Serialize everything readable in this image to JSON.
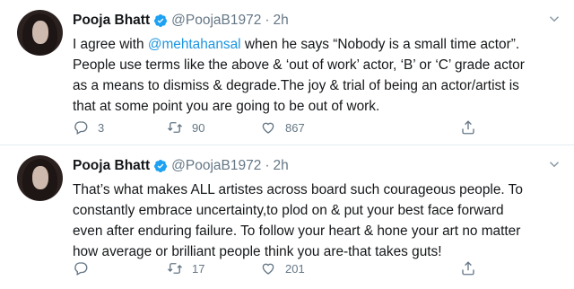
{
  "tweets": [
    {
      "name": "Pooja Bhatt",
      "handle": "@PoojaB1972",
      "dot": "·",
      "time": "2h",
      "lines": [
        {
          "pre": "I agree with ",
          "mention": "@mehtahansal",
          "post": " when he says “Nobody is a small time actor”."
        },
        {
          "text": "People use terms like the above & ‘out of work’ actor, ‘B’ or ‘C’ grade actor"
        },
        {
          "text": "as a means to dismiss & degrade.The joy & trial of being an actor/artist is"
        },
        {
          "text": "that at some point you are going to be out of work."
        }
      ],
      "replies": "3",
      "retweets": "90",
      "likes": "867"
    },
    {
      "name": "Pooja Bhatt",
      "handle": "@PoojaB1972",
      "dot": "·",
      "time": "2h",
      "lines": [
        {
          "text": "That’s what makes ALL artistes across board such courageous people. To"
        },
        {
          "text": "constantly embrace uncertainty,to plod on & put your best face forward"
        },
        {
          "text": "even after enduring failure. To follow your heart & hone your art no matter"
        },
        {
          "text": "how average or brilliant people think you are-that takes guts!"
        }
      ],
      "replies": "",
      "retweets": "17",
      "likes": "201"
    }
  ],
  "icons": {
    "verified": "verified-badge-icon",
    "reply": "reply-icon",
    "retweet": "retweet-icon",
    "like": "heart-icon",
    "share": "share-icon",
    "caret": "chevron-down-icon"
  },
  "colors": {
    "text": "#14171a",
    "secondary": "#657786",
    "accent": "#1b95e0",
    "divider": "#e6ecf0"
  }
}
